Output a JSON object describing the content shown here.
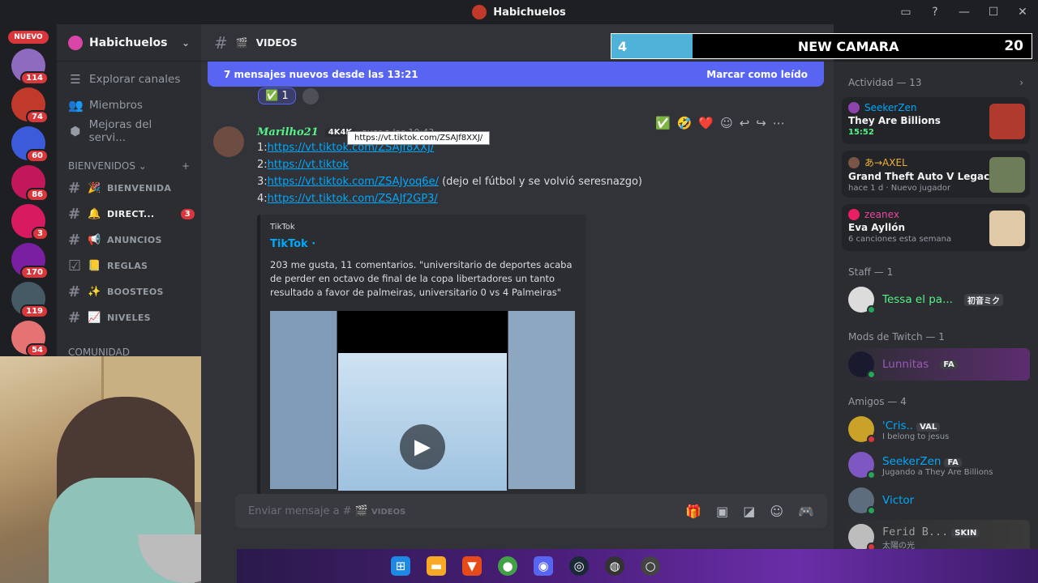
{
  "window": {
    "title": "Habichuelos"
  },
  "servers": {
    "nuevo_label": "NUEVO",
    "items": [
      {
        "badge": "114",
        "color": "#8e6bbf"
      },
      {
        "badge": "74",
        "color": "#c0392b"
      },
      {
        "badge": "60",
        "color": "#3b5bdb"
      },
      {
        "badge": "86",
        "color": "#c2185b"
      },
      {
        "badge": "3",
        "color": "#d81b60"
      },
      {
        "badge": "170",
        "color": "#7b1fa2"
      },
      {
        "badge": "119",
        "color": "#455a64"
      },
      {
        "badge": "54",
        "color": "#e57373"
      }
    ]
  },
  "sidebar": {
    "guild_name": "Habichuelos",
    "nav": [
      {
        "icon": "☰",
        "label": "Explorar canales"
      },
      {
        "icon": "👥",
        "label": "Miembros"
      },
      {
        "icon": "⬢",
        "label": "Mejoras del servi..."
      }
    ],
    "category": "BIENVENIDOS",
    "channels": [
      {
        "emoji": "🎉",
        "name": "BIENVENIDA",
        "badge": ""
      },
      {
        "emoji": "🔔",
        "name": "DIRECT...",
        "badge": "3"
      },
      {
        "emoji": "📢",
        "name": "ANUNCIOS",
        "badge": ""
      },
      {
        "emoji": "📒",
        "name": "REGLAS",
        "badge": ""
      },
      {
        "emoji": "✨",
        "name": "BOOSTEOS",
        "badge": ""
      },
      {
        "emoji": "📈",
        "name": "NIVELES",
        "badge": ""
      }
    ],
    "next_category": "COMUNIDAD"
  },
  "channel": {
    "emoji": "🎬",
    "name": "VIDEOS"
  },
  "overlay": {
    "count": "4",
    "label": "NEW CAMARA",
    "goal": "20"
  },
  "banner": {
    "text": "7 mensajes nuevos desde las 13:21",
    "action": "Marcar como leído"
  },
  "reaction": {
    "emoji": "✅",
    "count": "1"
  },
  "message": {
    "author": "Marilho21",
    "tag": "4K4K",
    "time": "ayer a las 10:43",
    "lines": [
      {
        "prefix": "1:",
        "url": "https://vt.tiktok.com/ZSAJf8XXJ/",
        "suffix": ""
      },
      {
        "prefix": "2:",
        "url": "https://vt.tiktok",
        "suffix": ""
      },
      {
        "prefix": "3:",
        "url": "https://vt.tiktok.com/ZSAJyoq6e/",
        "suffix": " (dejo el fútbol y se volvió seresnazgo)"
      },
      {
        "prefix": "4:",
        "url": "https://vt.tiktok.com/ZSAJf2GP3/",
        "suffix": ""
      }
    ],
    "tooltip": "https://vt.tiktok.com/ZSAJf8XXJ/",
    "hover_reactions": [
      "✅",
      "🤣",
      "❤️"
    ]
  },
  "embed": {
    "provider": "TikTok",
    "title": "TikTok ·",
    "description": "203 me gusta, 11 comentarios. \"universitario de deportes acaba de perder en octavo de final de la copa libertadores un tanto resultado a favor de palmeiras, universitario 0 vs 4 Palmeiras\""
  },
  "composer": {
    "placeholder_prefix": "Enviar mensaje a #",
    "placeholder_channel": "VIDEOS"
  },
  "members": {
    "activity_header": "Actividad — 13",
    "activities": [
      {
        "user": "SeekerZen",
        "game": "They Are Billions",
        "meta": "15:52",
        "meta_green": true,
        "art": "#b03a2e"
      },
      {
        "user": "あ→AXEL",
        "game": "Grand Theft Auto V Legacy",
        "meta": "hace 1 d · Nuevo jugador",
        "meta_green": false,
        "art": "#6d7d5a"
      },
      {
        "user": "zeanex",
        "game": "Eva Ayllón",
        "meta": "6 canciones esta semana",
        "meta_green": false,
        "art": "#e0c9a6"
      }
    ],
    "staff_header": "Staff — 1",
    "staff": [
      {
        "name": "Tessa el pa...",
        "chip": "初音ミク",
        "sub": ""
      }
    ],
    "mods_header": "Mods de Twitch — 1",
    "mods": [
      {
        "name": "Lunnitas",
        "chip": "FA",
        "sub": ""
      }
    ],
    "friends_header": "Amigos — 4",
    "friends": [
      {
        "name": "'Cris..",
        "chip": "VAL",
        "sub": "I belong to jesus"
      },
      {
        "name": "SeekerZen",
        "chip": "FA",
        "sub": "Jugando a They Are Billions"
      },
      {
        "name": "Victor",
        "chip": "",
        "sub": ""
      },
      {
        "name": "Ferid B...",
        "chip": "SKIN",
        "sub": "太陽の光"
      }
    ]
  },
  "colors": {
    "accent": "#5865f2",
    "link": "#00a8fc",
    "online": "#23a55a",
    "danger": "#da373c"
  }
}
